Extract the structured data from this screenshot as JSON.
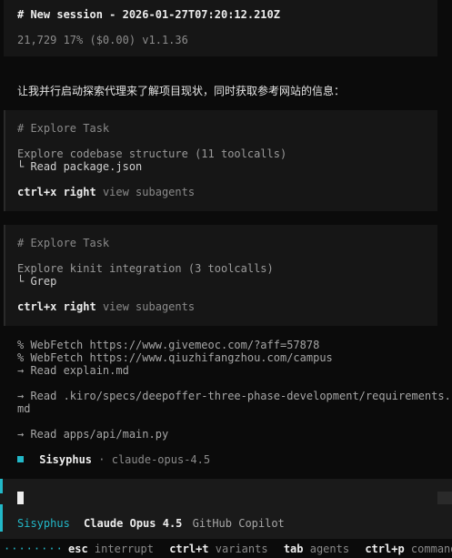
{
  "header": {
    "title": "# New session - 2026-01-27T07:20:12.210Z",
    "meta": "21,729  17% ($0.00) v1.1.36"
  },
  "assistant_message": "让我并行启动探索代理来了解项目现状，同时获取参考网站的信息：",
  "tasks": [
    {
      "heading": "# Explore Task",
      "description": "Explore codebase structure (11 toolcalls)",
      "last_action": "└ Read package.json",
      "shortcut_key": "ctrl+x right",
      "shortcut_hint": "view subagents"
    },
    {
      "heading": "# Explore Task",
      "description": "Explore kinit integration (3 toolcalls)",
      "last_action": "└ Grep",
      "shortcut_key": "ctrl+x right",
      "shortcut_hint": "view subagents"
    }
  ],
  "log_lines": [
    "% WebFetch https://www.givemeoc.com/?aff=57878",
    "% WebFetch https://www.qiuzhifangzhou.com/campus",
    "→ Read explain.md",
    "→ Read .kiro/specs/deepoffer-three-phase-development/requirements.",
    "md",
    "→ Read apps/api/main.py"
  ],
  "agent_status": {
    "name": "Sisyphus",
    "separator": "·",
    "model": "claude-opus-4.5"
  },
  "input": {
    "value": "",
    "placeholder": ""
  },
  "status_bar": {
    "agent": "Sisyphus",
    "model": "Claude Opus 4.5",
    "provider": "GitHub Copilot"
  },
  "footer": {
    "dots": "········",
    "shortcuts": [
      {
        "key": "esc",
        "desc": "interrupt"
      },
      {
        "key": "ctrl+t",
        "desc": "variants"
      },
      {
        "key": "tab",
        "desc": "agents"
      },
      {
        "key": "ctrl+p",
        "desc": "commands"
      }
    ]
  },
  "colors": {
    "accent": "#22b8c8",
    "background": "#0b0b0b",
    "panel": "#161616"
  }
}
